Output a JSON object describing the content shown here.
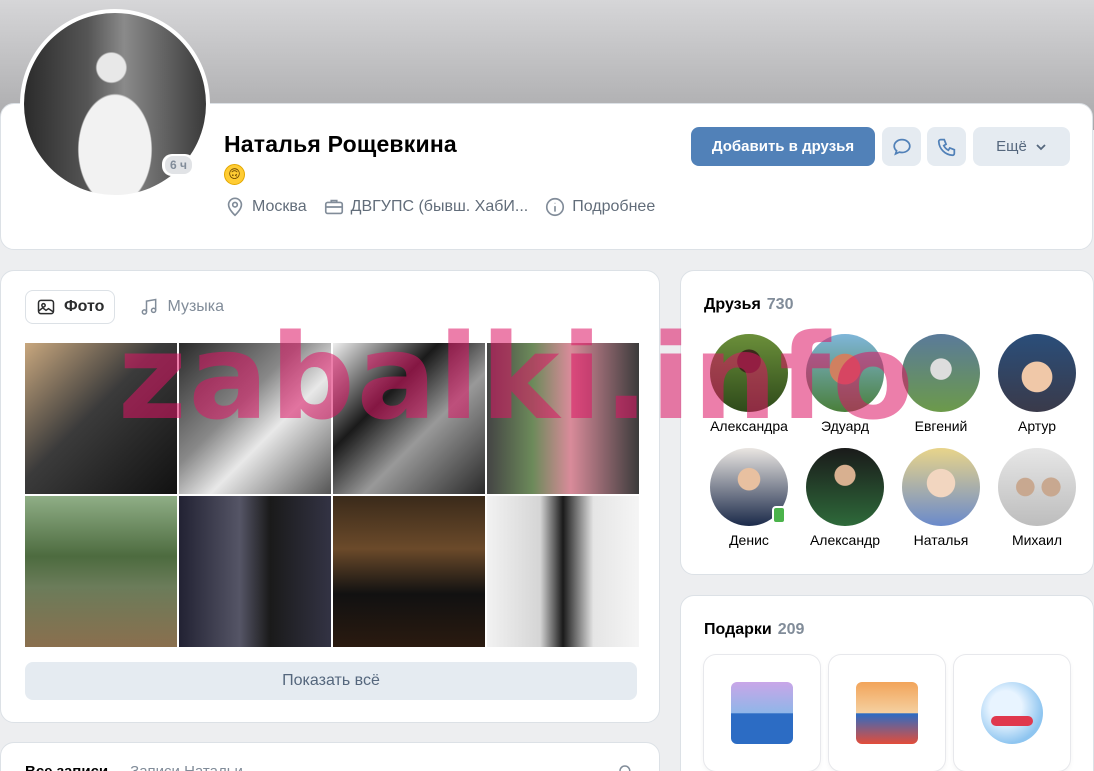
{
  "profile": {
    "name": "Наталья Рощевкина",
    "status_emoji": "🙃",
    "online_badge": "6 ч",
    "info": {
      "city": "Москва",
      "university": "ДВГУПС (бывш. ХабИ...",
      "more": "Подробнее"
    },
    "actions": {
      "add_friend": "Добавить в друзья",
      "more": "Ещё"
    }
  },
  "media": {
    "tabs": [
      {
        "label": "Фото",
        "active": true
      },
      {
        "label": "Музыка",
        "active": false
      }
    ],
    "show_all": "Показать всё"
  },
  "posts": {
    "tabs": [
      "Все записи",
      "Записи Натальи"
    ]
  },
  "friends": {
    "title": "Друзья",
    "count": "730",
    "items": [
      {
        "name": "Александра"
      },
      {
        "name": "Эдуард"
      },
      {
        "name": "Евгений"
      },
      {
        "name": "Артур"
      },
      {
        "name": "Денис"
      },
      {
        "name": "Александр"
      },
      {
        "name": "Наталья"
      },
      {
        "name": "Михаил"
      }
    ]
  },
  "gifts": {
    "title": "Подарки",
    "count": "209"
  },
  "watermark": "zabalki.info",
  "colors": {
    "accent": "#5181b8",
    "secondary_button": "#e5ebf1",
    "background": "#edeef0",
    "watermark": "#dc1464"
  }
}
